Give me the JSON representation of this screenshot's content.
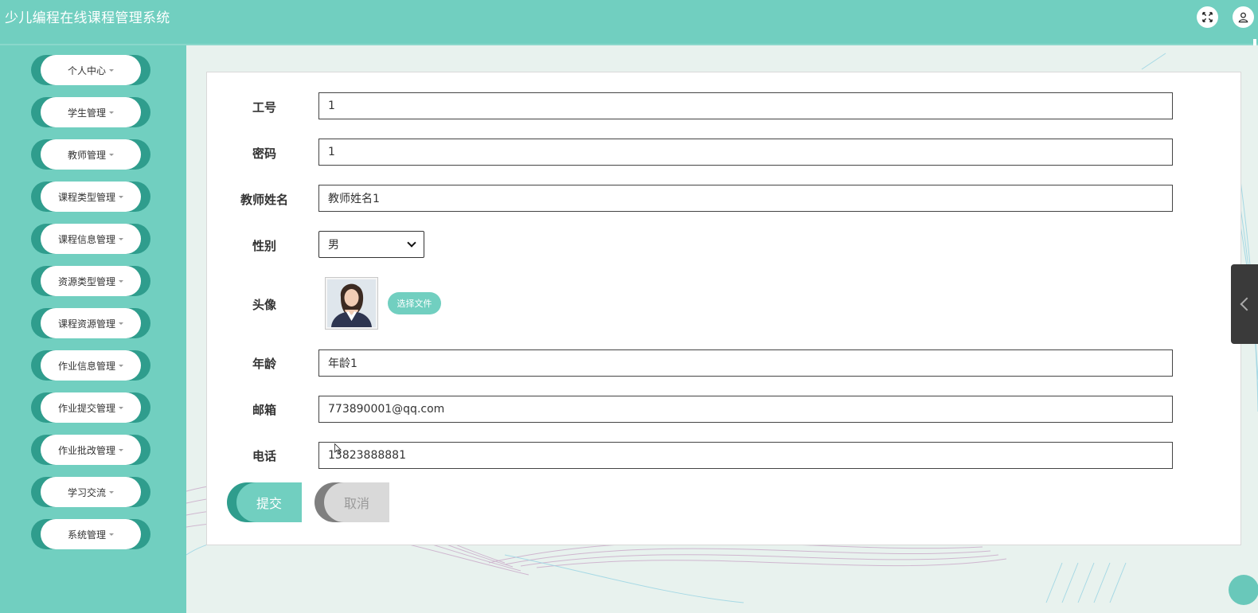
{
  "app": {
    "title": "少儿编程在线课程管理系统"
  },
  "sidebar": {
    "items": [
      {
        "label": "个人中心"
      },
      {
        "label": "学生管理"
      },
      {
        "label": "教师管理"
      },
      {
        "label": "课程类型管理"
      },
      {
        "label": "课程信息管理"
      },
      {
        "label": "资源类型管理"
      },
      {
        "label": "课程资源管理"
      },
      {
        "label": "作业信息管理"
      },
      {
        "label": "作业提交管理"
      },
      {
        "label": "作业批改管理"
      },
      {
        "label": "学习交流"
      },
      {
        "label": "系统管理"
      }
    ]
  },
  "form": {
    "job_no": {
      "label": "工号",
      "value": "1"
    },
    "password": {
      "label": "密码",
      "value": "1"
    },
    "teacher_name": {
      "label": "教师姓名",
      "value": "教师姓名1"
    },
    "gender": {
      "label": "性别",
      "value": "男"
    },
    "avatar": {
      "label": "头像",
      "button": "选择文件"
    },
    "age": {
      "label": "年龄",
      "value": "年龄1"
    },
    "email": {
      "label": "邮箱",
      "value": "773890001@qq.com"
    },
    "phone": {
      "label": "电话",
      "value": "13823888881"
    }
  },
  "actions": {
    "submit": "提交",
    "cancel": "取消"
  },
  "colors": {
    "primary": "#71cfc0",
    "primary_dark": "#2f9d8d",
    "cancel": "#d9d9d9"
  },
  "icons": {
    "fullscreen": "fullscreen-icon",
    "user": "user-icon",
    "collapse": "chevron-left-icon"
  }
}
